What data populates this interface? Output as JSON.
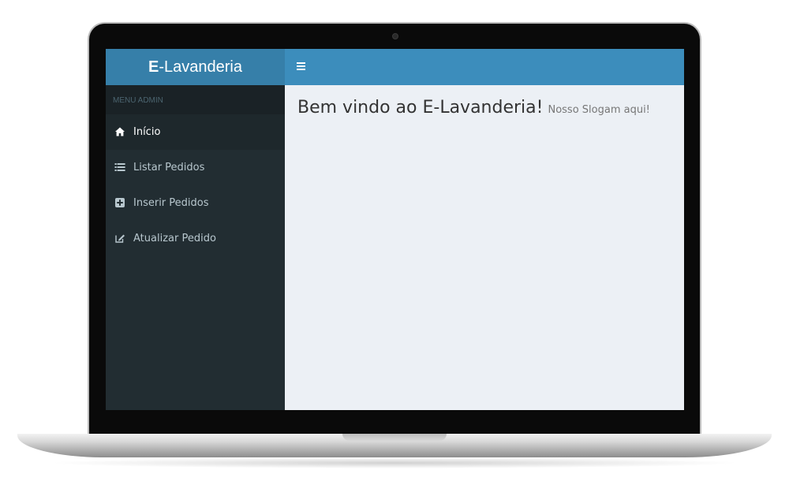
{
  "app": {
    "logo_prefix": "E",
    "logo_suffix": "-Lavanderia"
  },
  "sidebar": {
    "header": "MENU ADMIN",
    "items": [
      {
        "label": "Início",
        "icon": "home-icon",
        "active": true
      },
      {
        "label": "Listar Pedidos",
        "icon": "list-icon",
        "active": false
      },
      {
        "label": "Inserir Pedidos",
        "icon": "plus-square-icon",
        "active": false
      },
      {
        "label": "Atualizar Pedido",
        "icon": "edit-icon",
        "active": false
      }
    ]
  },
  "content": {
    "title": "Bem vindo ao E-Lavanderia!",
    "subtitle": "Nosso Slogam aqui!"
  },
  "colors": {
    "logo_bg": "#367fa9",
    "navbar_bg": "#3c8dbc",
    "sidebar_bg": "#222d32",
    "content_bg": "#ecf0f5"
  }
}
